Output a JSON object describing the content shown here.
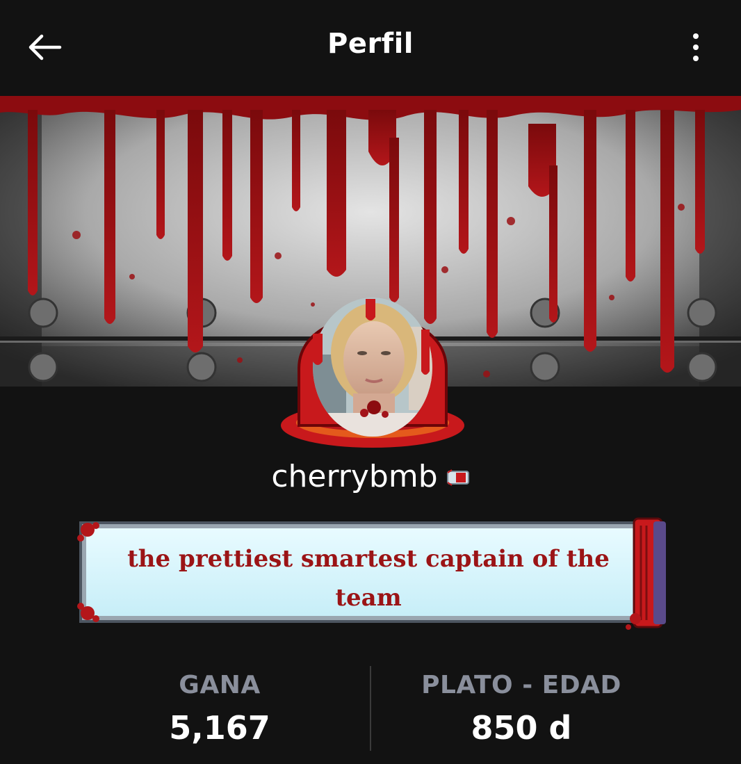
{
  "header": {
    "title": "Perfil",
    "back_icon": "arrow-left-icon",
    "menu_icon": "more-vertical-icon"
  },
  "banner": {
    "description_colors": {
      "blood": "#9c0f12",
      "metal": "#b8b8b8",
      "dark": "#1a1a1a"
    }
  },
  "profile": {
    "username": "cherrybmb",
    "badge_icon": "level-badge-icon",
    "bio": "the prettiest smartest captain of the team"
  },
  "stats": [
    {
      "label": "GANA",
      "value": "5,167"
    },
    {
      "label": "PLATO - EDAD",
      "value": "850 d"
    }
  ],
  "colors": {
    "background": "#121212",
    "text": "#ffffff",
    "stat_label": "#8a8f9c",
    "bio_text": "#9b1416",
    "bio_bg": "#d6f6fc",
    "accent_red": "#c8191c"
  }
}
